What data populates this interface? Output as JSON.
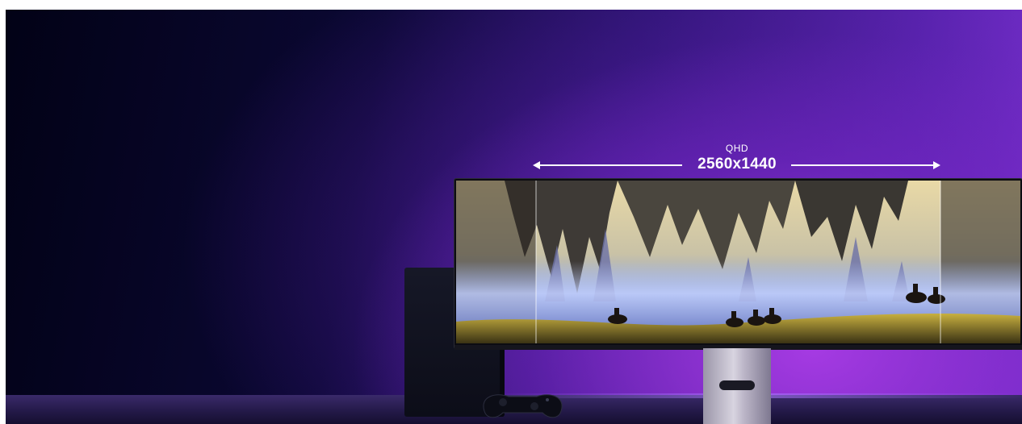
{
  "resolution": {
    "name": "QHD",
    "value": "2560x1440"
  },
  "colors": {
    "accent_purple": "#7a30d0",
    "background_dark": "#020216",
    "text": "#ffffff"
  }
}
